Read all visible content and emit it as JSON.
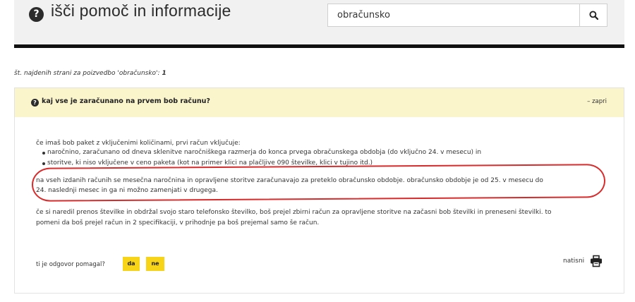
{
  "header": {
    "title": "išči pomoč in informacije",
    "help_glyph": "?",
    "search": {
      "value": "obračunsko",
      "button_icon": "search-icon"
    }
  },
  "results": {
    "label": "št. najdenih strani za poizvedbo 'obračunsko':",
    "count": "1"
  },
  "question": {
    "title": "kaj vse je zaračunano na prvem bob računu?",
    "collapse_label": "– zapri",
    "intro": "če imaš bob paket z vključenimi količinami, prvi račun vključuje:",
    "bullets": [
      "naročnino, zaračunano od dneva sklenitve naročniškega razmerja do konca prvega obračunskega obdobja (do vključno 24. v mesecu) in",
      "storitve, ki niso vključene v ceno paketa (kot na primer klici na plačljive 090 številke, klici v tujino itd.)"
    ],
    "highlight_lines": [
      "na vseh izdanih računih se mesečna naročnina in opravljene storitve zaračunavajo za preteklo obračunsko obdobje. obračunsko obdobje je od 25. v mesecu do",
      "24. naslednji mesec in ga ni možno zamenjati v drugega."
    ],
    "transfer_lines": [
      "če si naredil prenos številke in obdržal svojo staro telefonsko številko, boš prejel zbirni račun za opravljene storitve na začasni bob številki in preneseni številki. to",
      "pomeni da boš prejel račun in 2 specifikaciji, v prihodnje pa boš prejemal samo še račun."
    ]
  },
  "feedback": {
    "label": "ti je odgovor pomagal?",
    "yes": "da",
    "no": "ne"
  },
  "print": {
    "label": "natisni",
    "icon": "printer-icon"
  },
  "colors": {
    "accent_yellow": "#f7d417",
    "panel_header_bg": "#fbf5cc",
    "annotation_red": "#d92b2b",
    "header_bg": "#f1f1f1"
  }
}
